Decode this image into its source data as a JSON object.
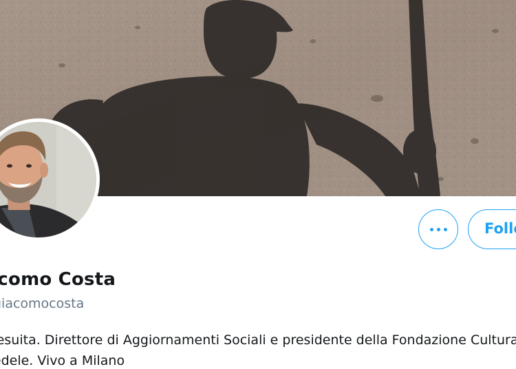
{
  "profile": {
    "display_name": "Giacomo Costa",
    "handle": "@giacomocosta",
    "bio_line_1": "Gesuita. Direttore di Aggiornamenti Sociali e presidente della Fondazione Culturale San",
    "bio_line_2": "Fedele. Vivo a Milano"
  },
  "actions": {
    "more_label": "More",
    "follow_label": "Follow"
  },
  "colors": {
    "accent": "#1da1f2",
    "name_text": "#14171a",
    "secondary_text": "#657786"
  },
  "icons": {
    "more": "more-dots-icon"
  }
}
